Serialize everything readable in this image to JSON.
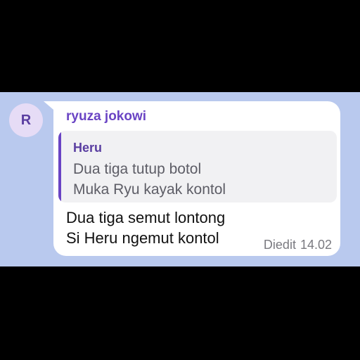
{
  "avatar": {
    "initial": "R"
  },
  "message": {
    "sender": "ryuza jokowi",
    "reply": {
      "author": "Heru",
      "lines": [
        "Dua tiga tutup botol",
        "Muka Ryu kayak kontol"
      ]
    },
    "lines": [
      "Dua tiga semut lontong",
      "Si Heru ngemut kontol"
    ],
    "edited_label": "Diedit",
    "time": "14.02"
  },
  "colors": {
    "chat_background": "#b9c9ee",
    "accent": "#6a44c4",
    "bubble": "#ffffff"
  }
}
